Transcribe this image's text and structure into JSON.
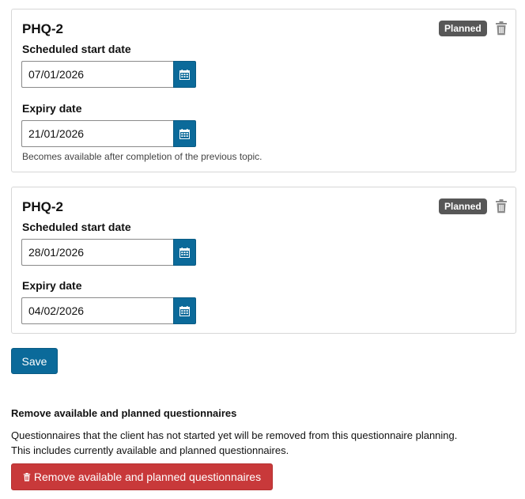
{
  "colors": {
    "primary": "#0b6a9a",
    "danger": "#c8393a",
    "badge": "#575757",
    "card_border": "#d7d7d7"
  },
  "questionnaires": [
    {
      "title": "PHQ-2",
      "status": "Planned",
      "start_label": "Scheduled start date",
      "start_value": "07/01/2026",
      "expiry_label": "Expiry date",
      "expiry_value": "21/01/2026",
      "help": "Becomes available after completion of the previous topic."
    },
    {
      "title": "PHQ-2",
      "status": "Planned",
      "start_label": "Scheduled start date",
      "start_value": "28/01/2026",
      "expiry_label": "Expiry date",
      "expiry_value": "04/02/2026"
    }
  ],
  "icons": {
    "delete": "trash-icon",
    "calendar": "calendar-icon"
  },
  "save_label": "Save",
  "remove_section": {
    "title": "Remove available and planned questionnaires",
    "line1": "Questionnaires that the client has not started yet will be removed from this questionnaire planning.",
    "line2": "This includes currently available and planned questionnaires.",
    "button_label": "Remove available and planned questionnaires"
  }
}
